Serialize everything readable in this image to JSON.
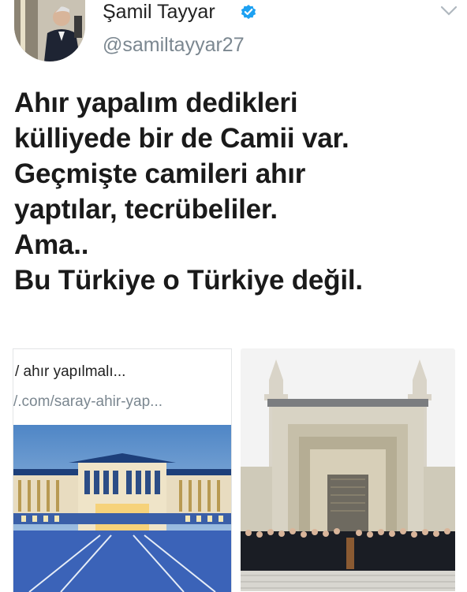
{
  "author": {
    "name": "Şamil Tayyar",
    "handle": "@samiltayyar27",
    "verified": true,
    "verified_color": "#1da1f2"
  },
  "tweet": {
    "lines": [
      "Ahır yapalım dedikleri",
      "külliyede bir de Camii var.",
      "Geçmişte camileri ahır",
      "yaptılar, tecrübeliler.",
      "Ama..",
      "Bu Türkiye o Türkiye değil."
    ]
  },
  "link_card": {
    "title": "/ ahır yapılmalı...",
    "url": "/.com/saray-ahir-yap..."
  },
  "icons": {
    "verified": "verified-badge-icon",
    "menu": "chevron-down-icon"
  }
}
